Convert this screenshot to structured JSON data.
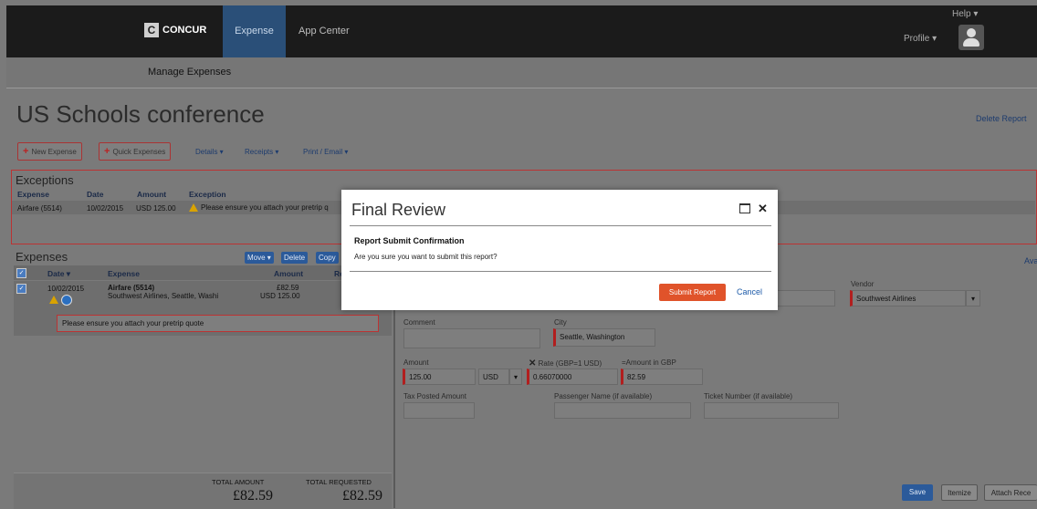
{
  "topnav": {
    "logo_text": "CONCUR",
    "tabs": [
      "Expense",
      "App Center"
    ],
    "help": "Help ▾",
    "profile": "Profile ▾"
  },
  "subnav": {
    "manage": "Manage Expenses"
  },
  "report": {
    "title": "US Schools conference",
    "delete_report": "Delete Report"
  },
  "toolbar": {
    "new_expense": "New Expense",
    "quick_expenses": "Quick Expenses",
    "details": "Details ▾",
    "receipts": "Receipts ▾",
    "print_email": "Print / Email ▾"
  },
  "exceptions": {
    "title": "Exceptions",
    "headers": {
      "expense": "Expense",
      "date": "Date",
      "amount": "Amount",
      "exception": "Exception"
    },
    "rows": [
      {
        "expense": "Airfare (5514)",
        "date": "10/02/2015",
        "amount": "USD 125.00",
        "exception": "Please ensure you attach your pretrip q"
      }
    ]
  },
  "expenses": {
    "title": "Expenses",
    "buttons": {
      "move": "Move ▾",
      "delete": "Delete",
      "copy": "Copy"
    },
    "headers": {
      "date": "Date ▾",
      "expense": "Expense",
      "amount": "Amount",
      "requested": "Re"
    },
    "rows": [
      {
        "date": "10/02/2015",
        "name": "Airfare (5514)",
        "vendor": "Southwest Airlines, Seattle, Washi",
        "amount": "£82.59",
        "amount_usd": "USD 125.00",
        "note": "Please ensure you attach your pretrip quote"
      }
    ],
    "totals": {
      "total_amount_label": "TOTAL AMOUNT",
      "total_amount": "£82.59",
      "total_requested_label": "TOTAL REQUESTED",
      "total_requested": "£82.59"
    }
  },
  "form": {
    "available": "Ava",
    "vendor_label": "Vendor",
    "vendor_value": "Southwest Airlines",
    "comment_label": "Comment",
    "city_label": "City",
    "city_value": "Seattle, Washington",
    "amount_label": "Amount",
    "amount_value": "125.00",
    "currency_value": "USD",
    "rate_label": "Rate (GBP=1 USD)",
    "rate_value": "0.66070000",
    "amount_gbp_label": "=Amount in GBP",
    "amount_gbp_value": "82.59",
    "tax_label": "Tax Posted Amount",
    "passenger_label": "Passenger Name (if available)",
    "ticket_label": "Ticket Number (if available)"
  },
  "footer": {
    "save": "Save",
    "itemize": "Itemize",
    "attach": "Attach Rece"
  },
  "modal": {
    "title": "Final Review",
    "subtitle": "Report Submit Confirmation",
    "question": "Are you sure you want to submit this report?",
    "submit": "Submit Report",
    "cancel": "Cancel"
  },
  "colors": {
    "brand_blue": "#2a4f78",
    "accent_orange": "#e0532a",
    "required_red": "#b21e1e"
  }
}
